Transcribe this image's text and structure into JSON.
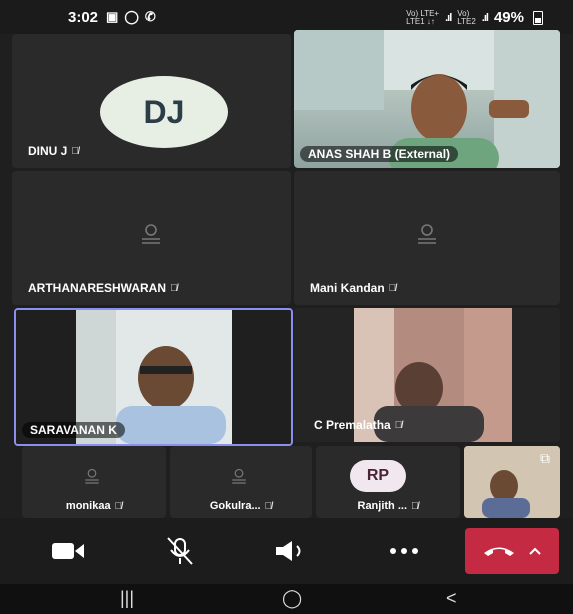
{
  "status": {
    "time": "3:02",
    "net1": "Vo)) LTE+\nLTE1 ↓↑",
    "net2": "Vo)) \nLTE2",
    "battery": "49%"
  },
  "tiles": [
    {
      "name": "DINU J",
      "initials": "DJ",
      "muted": true
    },
    {
      "name": "ANAS SHAH B (External)",
      "muted": false,
      "video": true
    },
    {
      "name": "ARTHANARESHWARAN",
      "muted": true
    },
    {
      "name": "Mani Kandan",
      "muted": true
    },
    {
      "name": "SARAVANAN K",
      "muted": false,
      "video": true,
      "selected": true
    },
    {
      "name": "C Premalatha",
      "muted": true,
      "video": true
    }
  ],
  "bottom_tiles": [
    {
      "name": "monikaa",
      "muted": true
    },
    {
      "name": "Gokulra...",
      "muted": true
    },
    {
      "name": "Ranjith ...",
      "initials": "RP",
      "muted": true
    }
  ],
  "controls": {
    "camera": "camera-icon",
    "mic": "mic-off-icon",
    "speaker": "speaker-icon",
    "more": "more-icon",
    "end": "end-call-icon"
  },
  "colors": {
    "accent_selected": "#8a8ff0",
    "end_call": "#c42b42"
  }
}
